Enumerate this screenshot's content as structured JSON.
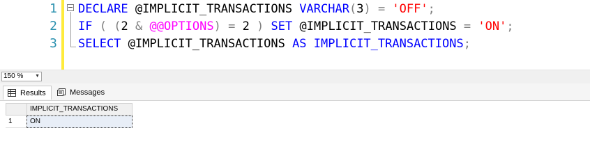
{
  "editor": {
    "line_numbers": [
      "1",
      "2",
      "3"
    ],
    "line1": {
      "t1": "DECLARE",
      "t2": " @IMPLICIT_TRANSACTIONS ",
      "t3": "VARCHAR",
      "t4": "(",
      "t5": "3",
      "t6": ")",
      "t7": " = ",
      "t8": "'OFF'",
      "t9": ";"
    },
    "line2": {
      "t1": "IF",
      "t2": " ",
      "t3": "(",
      "t4": " ",
      "t5": "(",
      "t6": "2 ",
      "t7": "&",
      "t8": " ",
      "t9": "@@OPTIONS",
      "t10": ")",
      "t11": " = ",
      "t12": "2 ",
      "t13": ")",
      "t14": " ",
      "t15": "SET",
      "t16": " @IMPLICIT_TRANSACTIONS ",
      "t17": "=",
      "t18": " ",
      "t19": "'ON'",
      "t20": ";"
    },
    "line3": {
      "t1": "SELECT",
      "t2": " @IMPLICIT_TRANSACTIONS ",
      "t3": "AS",
      "t4": " IMPLICIT_TRANSACTIONS",
      "t5": ";"
    }
  },
  "zoom": {
    "value": "150 %",
    "arrow_icon": "chevron-down-icon"
  },
  "tabs": {
    "results_label": "Results",
    "messages_label": "Messages",
    "results_icon": "grid-icon",
    "messages_icon": "messages-icon"
  },
  "grid": {
    "columns": [
      "IMPLICIT_TRANSACTIONS"
    ],
    "rows": [
      {
        "row_num": "1",
        "values": [
          "ON"
        ]
      }
    ]
  },
  "colors": {
    "keyword": "#0000ff",
    "string": "#ff0000",
    "operator": "#808080",
    "system_function": "#ff00ff",
    "line_number": "#2b91af",
    "change_bar": "#ffeb3b"
  }
}
